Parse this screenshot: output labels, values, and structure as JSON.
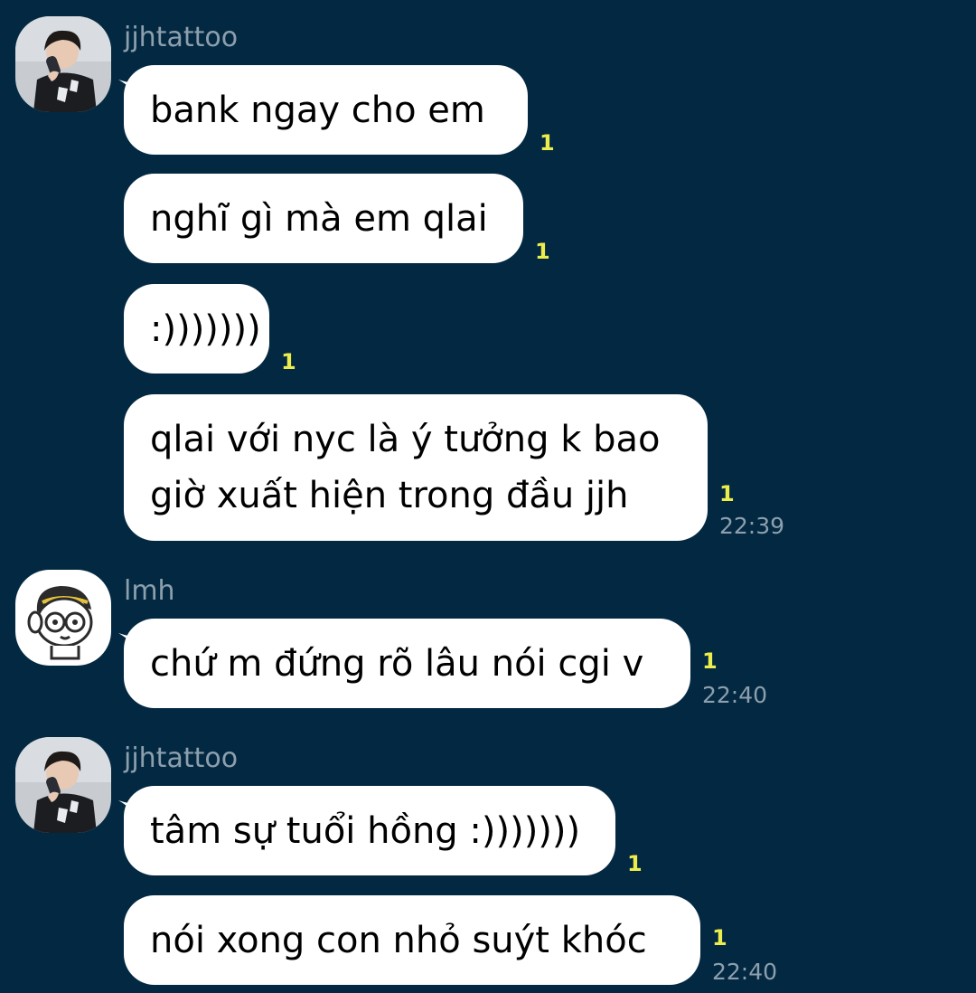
{
  "colors": {
    "background": "#032942",
    "bubble": "#ffffff",
    "message_text": "#000000",
    "sender_name": "#8d9fad",
    "unread_count": "#ecec4c",
    "timestamp": "#8d9fad"
  },
  "groups": [
    {
      "sender": "jjhtattoo",
      "avatar_icon": "user-photo-avatar",
      "messages": [
        {
          "text": "bank ngay cho em",
          "unread": "1",
          "time": ""
        },
        {
          "text": "nghĩ gì mà em qlai",
          "unread": "1",
          "time": ""
        },
        {
          "text": ":)))))))",
          "unread": "1",
          "time": ""
        },
        {
          "text": "qlai với nyc là ý tưởng k bao\ngiờ xuất hiện trong đầu jjh",
          "unread": "1",
          "time": "22:39"
        }
      ]
    },
    {
      "sender": "lmh",
      "avatar_icon": "cartoon-boy-glasses-avatar",
      "messages": [
        {
          "text": "chứ m đứng rõ lâu nói cgi v",
          "unread": "1",
          "time": "22:40"
        }
      ]
    },
    {
      "sender": "jjhtattoo",
      "avatar_icon": "user-photo-avatar",
      "messages": [
        {
          "text": "tâm sự tuổi hồng :)))))))",
          "unread": "1",
          "time": ""
        },
        {
          "text": "nói xong con nhỏ suýt khóc",
          "unread": "1",
          "time": "22:40"
        }
      ]
    }
  ]
}
